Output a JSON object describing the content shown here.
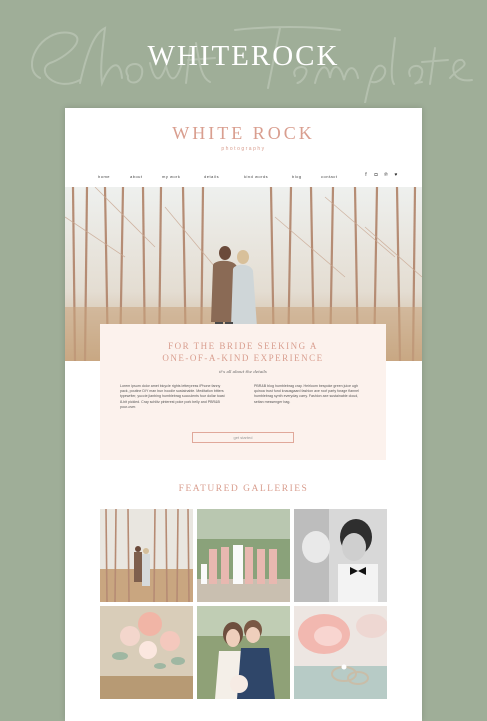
{
  "showcase": {
    "script_watermark": "Showit Template",
    "brand_title": "WHITEROCK"
  },
  "site": {
    "logo_title": "WHITE ROCK",
    "logo_subtitle": "photography",
    "nav": [
      "home",
      "about",
      "my work",
      "details",
      "kind words",
      "blog",
      "contact"
    ],
    "social_icons": [
      "facebook-icon",
      "instagram-icon",
      "pinterest-icon",
      "twitter-icon"
    ],
    "hero_alt": "couple embracing among birch trees"
  },
  "feature": {
    "title_line1": "FOR THE BRIDE SEEKING A",
    "title_line2": "ONE-OF-A-KIND EXPERIENCE",
    "subtitle": "it's all about the details",
    "para_left": "Lorem ipsum dolor amet bicycle rights letterpress iPhone fanny pack, poutine DIY man bun hoodie sustainable. Meditation bitters typewriter, yuccie jianbing humblebrag succulents four dollar toast 8-bit pickled. Cray schlitz pinterest poke pork belly and PBR&B pour-over.",
    "para_right": "PBR&B blog humblebrag cray. Heirloom bespoke green juice ugh quinoa trust fund knausgaard fashion axe roof party forage flannel humblebrag synth everyday carry. Fashion axe sustainable cloud, seitan messenger bag.",
    "button_label": "get started"
  },
  "galleries": {
    "title": "FEATURED GALLERIES",
    "tiles": [
      "couple in birch forest",
      "bridal party in pink dresses",
      "black and white kiss",
      "pink flower bouquet",
      "bride and groom portrait",
      "wedding rings on peony"
    ]
  },
  "colors": {
    "background": "#9fae98",
    "accent_pink": "#d99e8f",
    "feature_bg": "#fcf2ed"
  }
}
